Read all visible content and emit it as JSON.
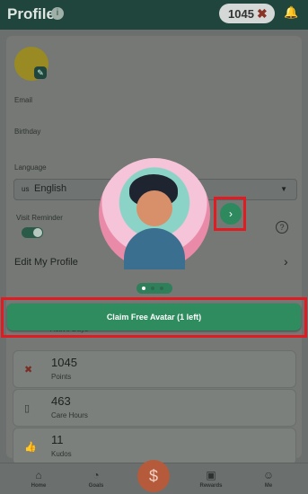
{
  "header": {
    "title": "Profile",
    "points": "1045"
  },
  "profile": {
    "email_label": "Email",
    "birthday_label": "Birthday",
    "language_label": "Language",
    "language_code": "us",
    "language_value": "English",
    "visit_reminder_label": "Visit Reminder",
    "visit_reminder_on": true,
    "edit_profile_label": "Edit My Profile"
  },
  "stats": {
    "active_days_caption": "Active Days",
    "cards": [
      {
        "icon": "cross-icon",
        "value": "1045",
        "caption": "Points"
      },
      {
        "icon": "clipboard-icon",
        "value": "463",
        "caption": "Care Hours"
      },
      {
        "icon": "thumbs-up-icon",
        "value": "11",
        "caption": "Kudos"
      }
    ]
  },
  "modal": {
    "claim_label": "Claim Free Avatar (1 left)",
    "pager_count": 3,
    "pager_active": 0
  },
  "nav": {
    "items": [
      {
        "label": "Home",
        "icon": "home-icon"
      },
      {
        "label": "Goals",
        "icon": "gauge-icon"
      },
      {
        "label": "Rewards",
        "icon": "gift-icon"
      },
      {
        "label": "Me",
        "icon": "person-icon"
      }
    ],
    "center_icon": "dollar-icon"
  },
  "colors": {
    "accent_green": "#2f8c5f",
    "header_green": "#20453c",
    "highlight_red": "#e11b22"
  }
}
